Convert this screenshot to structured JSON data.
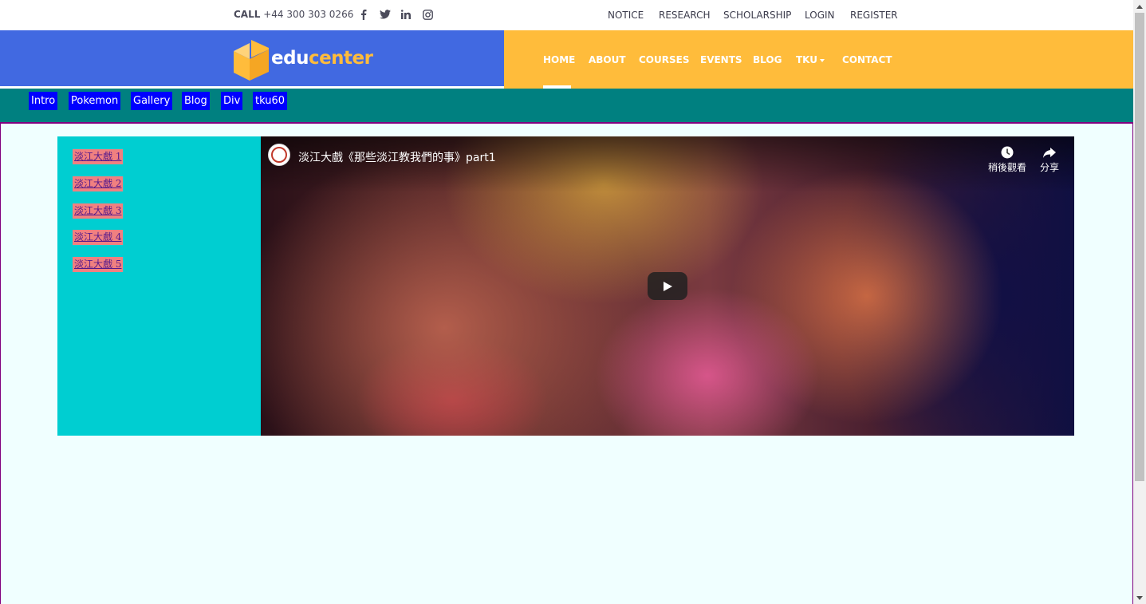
{
  "topbar": {
    "call_label": "CALL",
    "call_number": "+44 300 303 0266",
    "social": [
      "facebook-icon",
      "twitter-icon",
      "linkedin-icon",
      "instagram-icon"
    ],
    "links": [
      "NOTICE",
      "RESEARCH",
      "SCHOLARSHIP",
      "LOGIN",
      "REGISTER"
    ]
  },
  "logo": {
    "part1": "edu",
    "part2": "center"
  },
  "mainnav": {
    "items": [
      "HOME",
      "ABOUT",
      "COURSES",
      "EVENTS",
      "BLOG",
      "TKU",
      "CONTACT"
    ],
    "active": "HOME"
  },
  "tealnav": {
    "items": [
      "Intro",
      "Pokemon",
      "Gallery",
      "Blog",
      "Div",
      "tku60"
    ]
  },
  "sidebar": {
    "links": [
      "淡江大戲 1",
      "淡江大戲 2",
      "淡江大戲 3",
      "淡江大戲 4",
      "淡江大戲 5"
    ]
  },
  "video": {
    "title": "淡江大戲《那些淡江教我們的事》part1",
    "watch_later": "稍後觀看",
    "share": "分享"
  },
  "colors": {
    "header_blue": "#4169e1",
    "header_orange": "#ffbc3b",
    "teal": "#008080",
    "button_blue": "#0000ff",
    "sidebar_cyan": "#00ced1",
    "link_bg": "#f08080",
    "content_bg": "#f0ffff"
  }
}
